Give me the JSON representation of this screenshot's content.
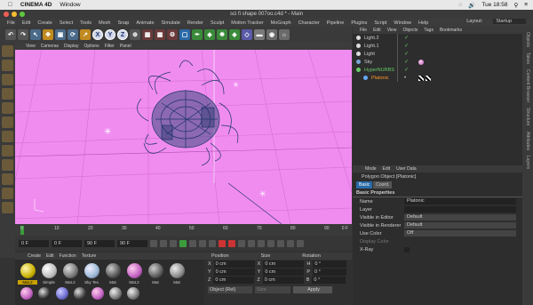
{
  "mac_menu": {
    "app": "CINEMA 4D",
    "window": "Window",
    "time": "Tue 18:58"
  },
  "window_title": "sci fi shape 007oo.c4d * - Main",
  "main_menu": [
    "File",
    "Edit",
    "Create",
    "Select",
    "Tools",
    "Mesh",
    "Snap",
    "Animate",
    "Simulate",
    "Render",
    "Sculpt",
    "Motion Tracker",
    "MoGraph",
    "Character",
    "Pipeline",
    "Plugins",
    "Script",
    "Window",
    "Help"
  ],
  "layout": {
    "label": "Layout:",
    "value": "Startup"
  },
  "toolbar_axes": [
    "X",
    "Y",
    "Z"
  ],
  "viewport_menu": [
    "View",
    "Cameras",
    "Display",
    "Options",
    "Filter",
    "Panel"
  ],
  "viewport_colors": {
    "background": "#f08cf0",
    "grid": "#d76bd8",
    "mesh": "#1e3366"
  },
  "timeline": {
    "ticks": [
      "0",
      "10",
      "20",
      "30",
      "40",
      "50",
      "60",
      "70",
      "80",
      "90"
    ],
    "end_label": "0 F"
  },
  "transport": {
    "start": "0 F",
    "current": "0 F",
    "end": "90 F",
    "max": "90 F"
  },
  "material_menu": [
    "Create",
    "Edit",
    "Function",
    "Texture"
  ],
  "materials": [
    {
      "label": "Mat.2",
      "color": "#c9b100"
    },
    {
      "label": "Simple",
      "color": "#d8d8d8"
    },
    {
      "label": "Mat.2",
      "color": "#8a8a8a"
    },
    {
      "label": "Sky Tex",
      "color": "#9bb8d6"
    },
    {
      "label": "Mat",
      "color": "#666666"
    },
    {
      "label": "Mat.2",
      "color": "#c060c0"
    },
    {
      "label": "Mat",
      "color": "#6a6a6a"
    },
    {
      "label": "Mat",
      "color": "#888888"
    }
  ],
  "coords": {
    "headers": [
      "Position",
      "Size",
      "Rotation"
    ],
    "rows": [
      {
        "axis": "X",
        "pos": "0 cm",
        "size_axis": "X",
        "size": "0 cm",
        "rot_axis": "H",
        "rot": "0 °"
      },
      {
        "axis": "Y",
        "pos": "0 cm",
        "size_axis": "Y",
        "size": "0 cm",
        "rot_axis": "P",
        "rot": "0 °"
      },
      {
        "axis": "Z",
        "pos": "0 cm",
        "size_axis": "Z",
        "size": "0 cm",
        "rot_axis": "B",
        "rot": "0 °"
      }
    ],
    "mode": "Object (Rel)",
    "size_mode": "Size",
    "apply": "Apply"
  },
  "object_manager": {
    "menu": [
      "File",
      "Edit",
      "View",
      "Objects",
      "Tags",
      "Bookmarks"
    ],
    "objects": [
      {
        "name": "Light.2",
        "color": "#dddddd"
      },
      {
        "name": "Light.1",
        "color": "#dddddd"
      },
      {
        "name": "Light",
        "color": "#dddddd"
      },
      {
        "name": "Sky",
        "color": "#7aa7d6"
      },
      {
        "name": "HyperNURBS",
        "color": "#66cc66"
      },
      {
        "name": "Platonic",
        "color": "#66aaff"
      }
    ]
  },
  "attributes": {
    "menu": [
      "Mode",
      "Edit",
      "User Data"
    ],
    "object_title": "Polygon Object [Platonic]",
    "tabs": [
      "Basic",
      "Coord."
    ],
    "section": "Basic Properties",
    "fields": [
      {
        "label": "Name",
        "value": "Platonic"
      },
      {
        "label": "Layer",
        "value": ""
      },
      {
        "label": "Visible in Editor",
        "value": "Default"
      },
      {
        "label": "Visible in Renderer",
        "value": "Default"
      },
      {
        "label": "Use Color",
        "value": "Off"
      },
      {
        "label": "Display Color",
        "value": ""
      },
      {
        "label": "X-Ray",
        "value": ""
      }
    ]
  },
  "right_tabs": [
    "Objects",
    "Takes",
    "Content Browser",
    "Structure",
    "Attributes",
    "Layers"
  ]
}
